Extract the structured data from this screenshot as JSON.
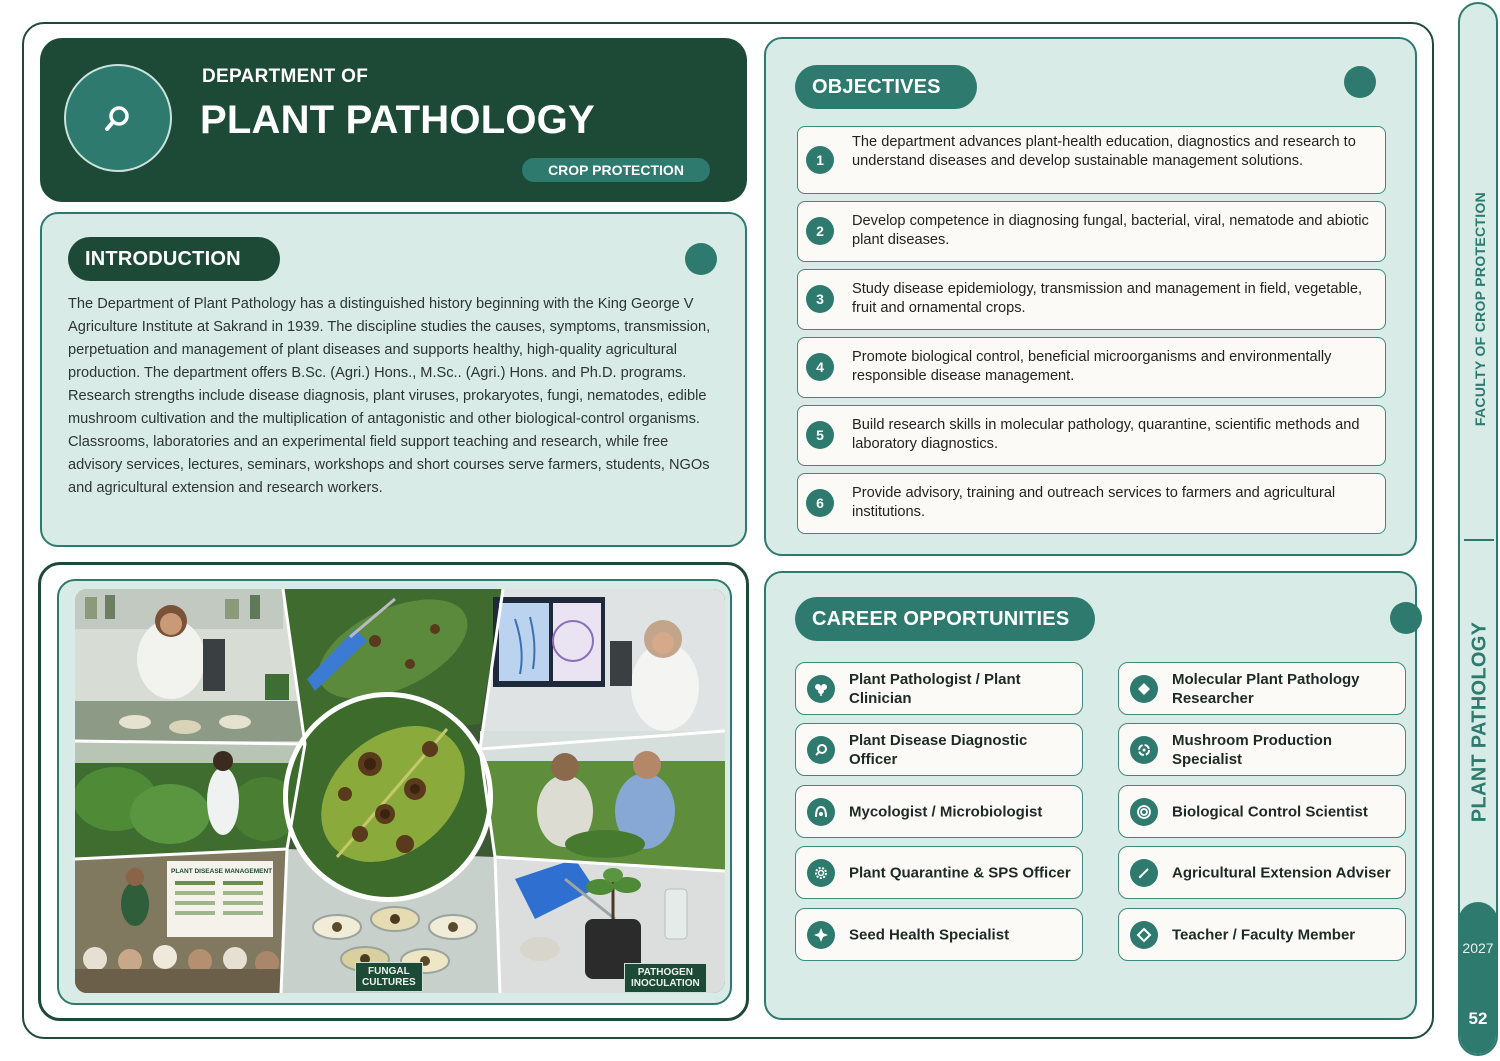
{
  "header": {
    "overline": "DEPARTMENT OF",
    "title": "PLANT PATHOLOGY",
    "badge": "CROP PROTECTION",
    "logo_icon": "magnifier-icon"
  },
  "introduction": {
    "heading": "INTRODUCTION",
    "body": "The Department of Plant Pathology has a distinguished history beginning with the King George V Agriculture Institute at Sakrand in 1939. The discipline studies the causes, symptoms, transmission, perpetuation and management of plant diseases and supports healthy, high-quality agricultural production. The department offers B.Sc. (Agri.) Hons., M.Sc.. (Agri.) Hons. and Ph.D. programs. Research strengths include disease diagnosis, plant viruses, prokaryotes, fungi, nematodes, edible mushroom cultivation and the multiplication of antagonistic and other biological-control organisms. Classrooms, laboratories and an experimental field support teaching and research, while free advisory services, lectures, seminars, workshops and short courses serve farmers, students, NGOs and agricultural extension and research workers."
  },
  "collage": {
    "label_left_1": "FUNGAL",
    "label_left_2": "CULTURES",
    "label_right_1": "PATHOGEN",
    "label_right_2": "INOCULATION",
    "poster_title": "PLANT DISEASE MANAGEMENT"
  },
  "objectives": {
    "heading": "OBJECTIVES",
    "items": [
      {
        "num": "1",
        "text": "The department advances plant-health education, diagnostics and research to understand diseases and develop sustainable management solutions."
      },
      {
        "num": "2",
        "text": "Develop competence in diagnosing fungal, bacterial, viral, nematode and abiotic plant diseases."
      },
      {
        "num": "3",
        "text": "Study disease epidemiology, transmission and management in field, vegetable, fruit and ornamental crops."
      },
      {
        "num": "4",
        "text": "Promote biological control, beneficial microorganisms and environmentally responsible disease management."
      },
      {
        "num": "5",
        "text": "Build research skills in molecular pathology, quarantine, scientific methods and laboratory diagnostics."
      },
      {
        "num": "6",
        "text": "Provide advisory, training and outreach services to farmers and agricultural institutions."
      }
    ]
  },
  "careers": {
    "heading": "CAREER OPPORTUNITIES",
    "items": [
      {
        "label": "Plant Pathologist / Plant Clinician",
        "icon": "leaf-icon"
      },
      {
        "label": "Molecular Plant Pathology Researcher",
        "icon": "diamond-icon"
      },
      {
        "label": "Plant Disease Diagnostic Officer",
        "icon": "search-icon"
      },
      {
        "label": "Mushroom Production Specialist",
        "icon": "recycle-icon"
      },
      {
        "label": "Mycologist / Microbiologist",
        "icon": "microbe-icon"
      },
      {
        "label": "Biological Control Scientist",
        "icon": "target-icon"
      },
      {
        "label": "Plant Quarantine & SPS Officer",
        "icon": "gear-icon"
      },
      {
        "label": "Agricultural Extension Adviser",
        "icon": "pen-icon"
      },
      {
        "label": "Seed Health Specialist",
        "icon": "sparkle-icon"
      },
      {
        "label": "Teacher / Faculty Member",
        "icon": "diamond-outline-icon"
      }
    ]
  },
  "sidebar": {
    "faculty": "FACULTY OF CROP PROTECTION",
    "department": "PLANT PATHOLOGY",
    "year": "2027",
    "page": "52"
  },
  "colors": {
    "dark_green": "#1d4a36",
    "teal": "#2e7a6e",
    "panel_bg": "#d8ebe7",
    "card_bg": "#fbfaf6"
  }
}
